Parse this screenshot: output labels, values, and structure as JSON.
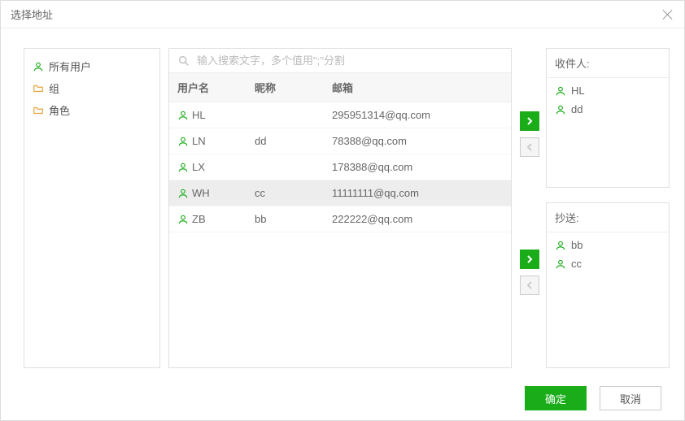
{
  "dialog": {
    "title": "选择地址"
  },
  "tree": {
    "items": [
      {
        "label": "所有用户",
        "icon": "person"
      },
      {
        "label": "组",
        "icon": "folder"
      },
      {
        "label": "角色",
        "icon": "folder"
      }
    ]
  },
  "search": {
    "placeholder": "输入搜索文字，多个值用\";\"分割"
  },
  "table": {
    "headers": {
      "user": "用户名",
      "nick": "昵称",
      "mail": "邮箱"
    },
    "rows": [
      {
        "user": "HL",
        "nick": "",
        "mail": "295951314@qq.com",
        "selected": false
      },
      {
        "user": "LN",
        "nick": "dd",
        "mail": "78388@qq.com",
        "selected": false
      },
      {
        "user": "LX",
        "nick": "",
        "mail": "178388@qq.com",
        "selected": false
      },
      {
        "user": "WH",
        "nick": "cc",
        "mail": "11111111@qq.com",
        "selected": true
      },
      {
        "user": "ZB",
        "nick": "bb",
        "mail": "222222@qq.com",
        "selected": false
      }
    ]
  },
  "panels": {
    "to": {
      "title": "收件人:",
      "items": [
        "HL",
        "dd<LN>"
      ]
    },
    "cc": {
      "title": "抄送:",
      "items": [
        "bb<ZB>",
        "cc<WH>"
      ]
    }
  },
  "buttons": {
    "ok": "确定",
    "cancel": "取消"
  },
  "colors": {
    "accent": "#1aad19"
  }
}
